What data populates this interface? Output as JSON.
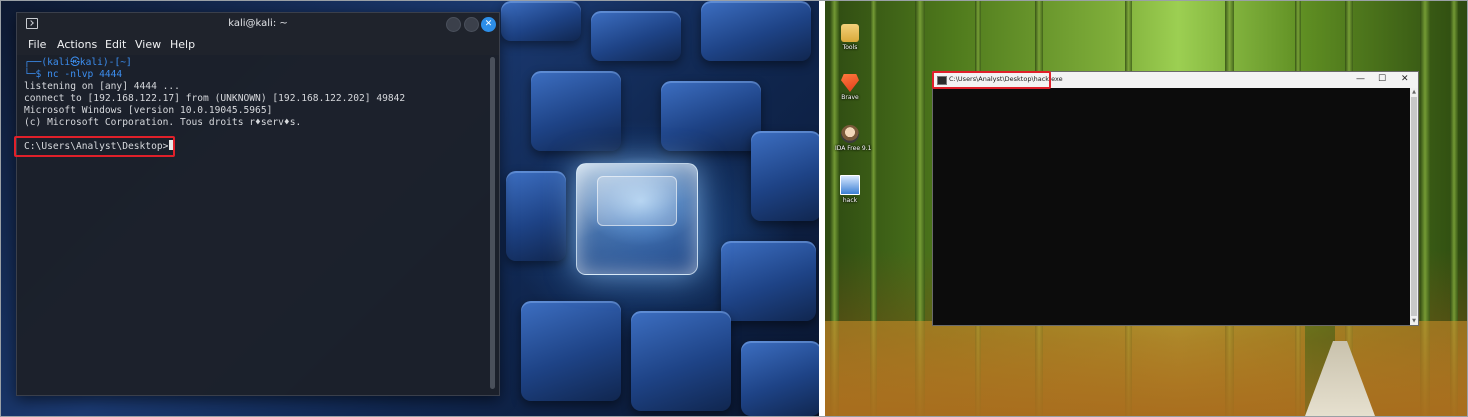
{
  "terminal": {
    "title": "kali@kali: ~",
    "menu": [
      "File",
      "Actions",
      "Edit",
      "View",
      "Help"
    ],
    "prompt": {
      "line1": "┌──(kali㉿kali)-[~]",
      "line2_prefix": "└─$",
      "command": "nc -nlvp 4444"
    },
    "output": [
      "listening on [any] 4444 ...",
      "connect to [192.168.122.17] from (UNKNOWN) [192.168.122.202] 49842",
      "Microsoft Windows [version 10.0.19045.5965]",
      "(c) Microsoft Corporation. Tous droits r♦serv♦s."
    ],
    "remote_prompt": "C:\\Users\\Analyst\\Desktop>",
    "close_glyph": "✕"
  },
  "windows_desktop": {
    "icons": [
      {
        "label": "Tools",
        "icon": "folder-icon"
      },
      {
        "label": "Brave",
        "icon": "brave-icon"
      },
      {
        "label": "IDA Free 9.1",
        "icon": "ida-icon"
      },
      {
        "label": "hack",
        "icon": "exe-icon"
      }
    ],
    "hack_window": {
      "title": "C:\\Users\\Analyst\\Desktop\\hack.exe",
      "min_glyph": "—",
      "max_glyph": "☐",
      "close_glyph": "✕"
    }
  },
  "colors": {
    "highlight_red": "#e0202a",
    "kali_blue": "#3c8ef0",
    "terminal_bg": "#1c202a"
  }
}
